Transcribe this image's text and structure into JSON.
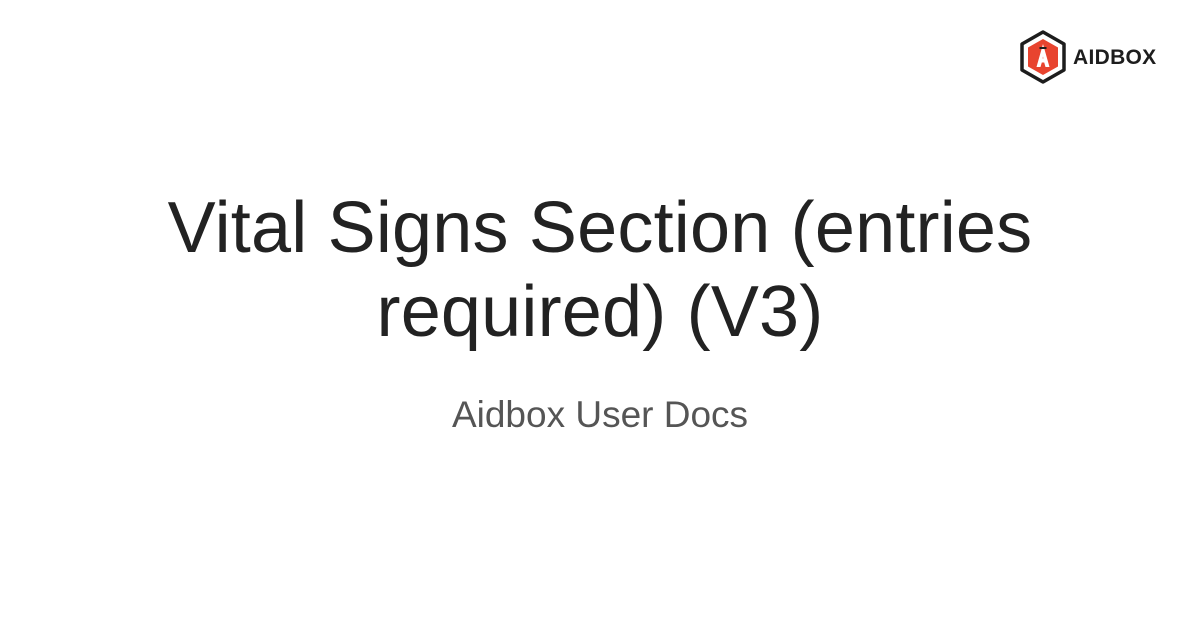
{
  "brand": {
    "name": "AIDBOX",
    "logo_icon": "aidbox-hexagon-logo-icon",
    "accent_color": "#e8442f",
    "mark_color": "#1d1d1d"
  },
  "page": {
    "title": "Vital Signs Section (entries required) (V3)",
    "subtitle": "Aidbox User Docs"
  }
}
